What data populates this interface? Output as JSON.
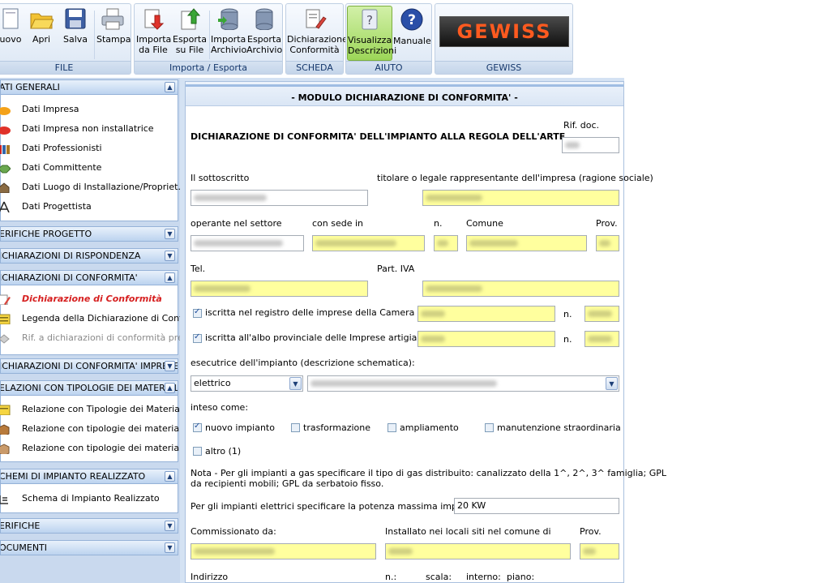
{
  "ribbon": {
    "groups": [
      {
        "label": "FILE"
      },
      {
        "label": "Importa / Esporta"
      },
      {
        "label": "SCHEDA"
      },
      {
        "label": "AIUTO"
      },
      {
        "label": "GEWISS"
      }
    ],
    "buttons": {
      "nuovo": "uovo",
      "apri": "Apri",
      "salva": "Salva",
      "stampa": "Stampa",
      "importa_file_1": "Importa",
      "importa_file_2": "da File",
      "esporta_file_1": "Esporta",
      "esporta_file_2": "su File",
      "importa_arch_1": "Importa",
      "importa_arch_2": "Archivio",
      "esporta_arch_1": "Esporta",
      "esporta_arch_2": "Archivio",
      "dich_1": "Dichiarazione",
      "dich_2": "Conformità",
      "vis_1": "Visualizza",
      "vis_2": "Descrizioni",
      "manuale": "Manuale"
    },
    "logo_text": "GEWISS"
  },
  "sidebar": {
    "sections": [
      {
        "title": "ATI GENERALI",
        "items": [
          "Dati Impresa",
          "Dati Impresa non installatrice",
          "Dati Professionisti",
          "Dati Committente",
          "Dati Luogo di Installazione/Propriet…",
          "Dati Progettista"
        ]
      },
      {
        "title": "ERIFICHE PROGETTO"
      },
      {
        "title": "ICHIARAZIONI DI RISPONDENZA"
      },
      {
        "title": "ICHIARAZIONI DI CONFORMITA'",
        "items": [
          "Dichiarazione di Conformità",
          "Legenda della Dichiarazione di Conf…",
          "Rif. a dichiarazioni di conformità pre…"
        ]
      },
      {
        "title": "ICHIARAZIONI DI CONFORMITA' IMPRESE"
      },
      {
        "title": "ELAZIONI CON TIPOLOGIE DEI MATERIALI",
        "items": [
          "Relazione con Tipologie dei Materiali…",
          "Relazione con tipologie dei materiali…",
          "Relazione con tipologie dei materiali…"
        ]
      },
      {
        "title": "CHEMI DI IMPIANTO REALIZZATO",
        "items": [
          "Schema di Impianto Realizzato"
        ]
      },
      {
        "title": "ERIFICHE"
      },
      {
        "title": "OCUMENTI"
      }
    ]
  },
  "form": {
    "module_title": "- MODULO DICHIARAZIONE DI CONFORMITA' -",
    "heading": "DICHIARAZIONE DI CONFORMITA' DELL'IMPIANTO ALLA REGOLA DELL'ARTE",
    "rif_doc": "Rif. doc.",
    "sottoscritto": "Il sottoscritto",
    "titolare": "titolare o legale rappresentante dell'impresa (ragione sociale)",
    "operante": "operante nel settore",
    "con_sede": "con sede in",
    "n": "n.",
    "comune": "Comune",
    "prov": "Prov.",
    "tel": "Tel.",
    "piva": "Part. IVA",
    "registro": "iscritta nel registro delle imprese della Camera C.I.A.",
    "albo": "iscritta all'albo provinciale delle Imprese artigiane di:",
    "esecutrice": "esecutrice dell'impianto (descrizione schematica):",
    "tipo_impianto": "elettrico",
    "inteso": "inteso come:",
    "opt_nuovo": "nuovo impianto",
    "opt_trasf": "trasformazione",
    "opt_ampl": "ampliamento",
    "opt_manut": "manutenzione straordinaria",
    "opt_altro": "altro (1)",
    "nota_1": "Nota - Per gli impianti a gas specificare il tipo di gas distribuito: canalizzato della 1^, 2^, 3^ famiglia; GPL",
    "nota_2": "da recipienti mobili; GPL da serbatoio fisso.",
    "potenza_label": "Per gli impianti elettrici specificare la potenza massima impegnabile:",
    "potenza_value": "20 KW",
    "commissionato": "Commissionato da:",
    "installato": "Installato nei locali siti nel comune di",
    "prov2": "Prov.",
    "indirizzo": "Indirizzo",
    "n2": "n.:",
    "scala": "scala:",
    "interno": "interno:",
    "piano": "piano:"
  },
  "colors": {
    "field_yellow": "#ffff9e",
    "panel_blue": "#c9d9ee",
    "hot_red": "#d62020"
  }
}
